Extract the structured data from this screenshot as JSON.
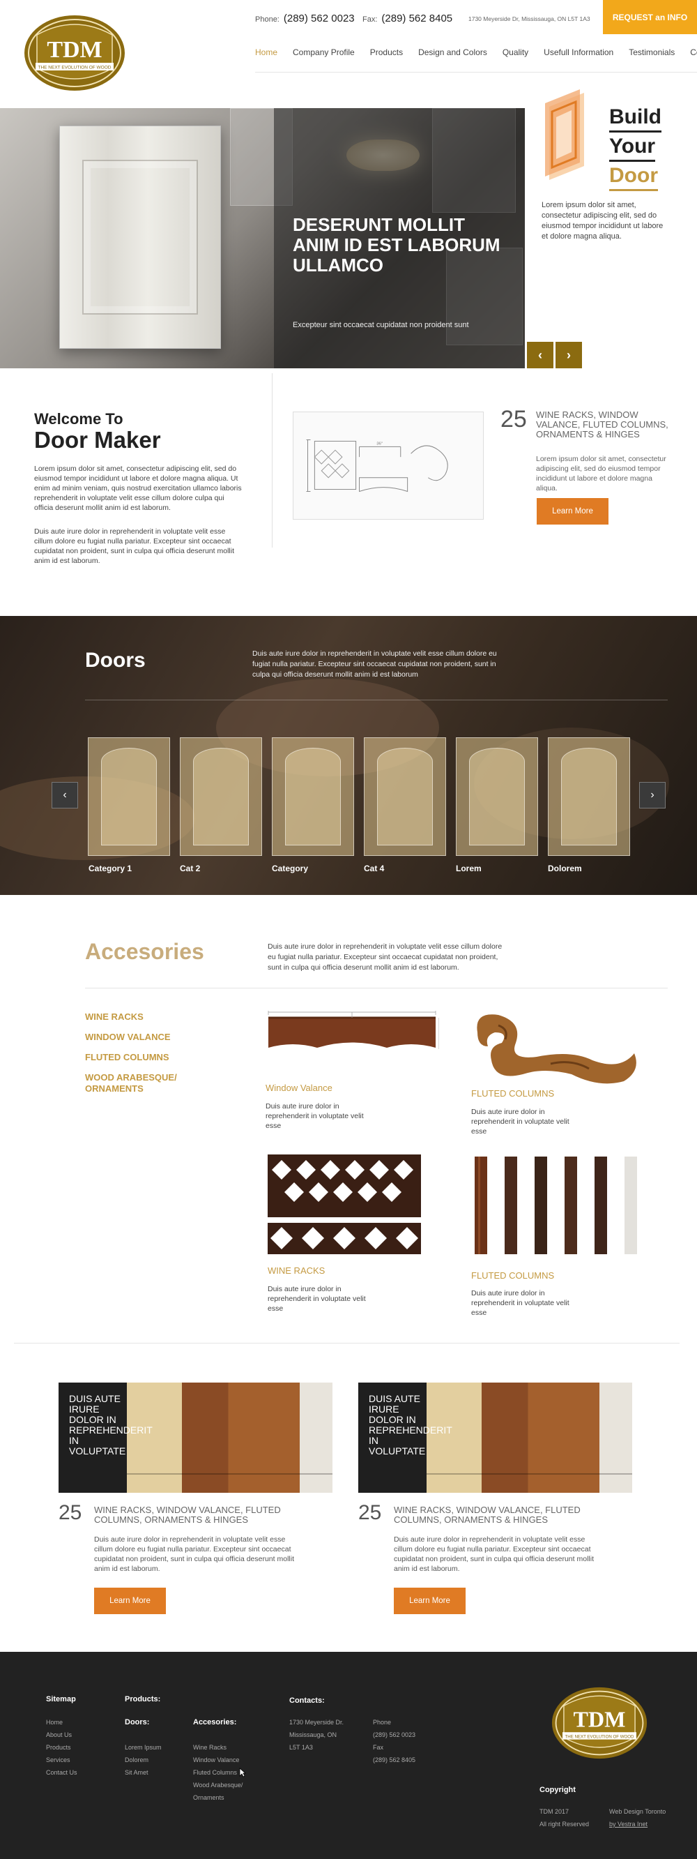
{
  "header": {
    "logo_text": "TDM",
    "logo_tagline": "THE NEXT EVOLUTION OF WOOD",
    "phone_label": "Phone:",
    "phone": "(289) 562 0023",
    "fax_label": "Fax:",
    "fax": "(289) 562 8405",
    "address": "1730 Meyerside Dr, Mississauga, ON L5T 1A3",
    "request_button": "REQUEST an INFO",
    "nav": [
      "Home",
      "Company Profile",
      "Products",
      "Design and Colors",
      "Quality",
      "Usefull Information",
      "Testimonials",
      "Contact Us"
    ]
  },
  "hero": {
    "title": "DESERUNT MOLLIT ANIM ID EST LABORUM ULLAMCO",
    "subtitle": "Excepteur sint occaecat cupidatat non proident sunt",
    "prev": "‹",
    "next": "›",
    "build_lines": [
      "Build",
      "Your",
      "Door"
    ],
    "build_text": "Lorem ipsum dolor sit amet, consectetur adipiscing elit, sed do eiusmod tempor incididunt ut labore et dolore magna aliqua."
  },
  "welcome": {
    "line1": "Welcome To",
    "line2": "Door Maker",
    "p1": "Lorem ipsum dolor sit amet, consectetur adipiscing elit, sed do eiusmod tempor incididunt ut labore et dolore magna aliqua. Ut enim ad minim veniam, quis nostrud exercitation ullamco laboris reprehenderit in voluptate velit esse cillum dolore culpa qui officia deserunt mollit anim id est laborum.",
    "p2": "Duis aute irure dolor in reprehenderit in voluptate velit esse cillum dolore eu fugiat nulla pariatur. Excepteur sint occaecat cupidatat non proident, sunt in culpa qui officia deserunt mollit anim id est laborum.",
    "number": "25",
    "feature_title": "WINE RACKS, WINDOW VALANCE, FLUTED COLUMNS, ORNAMENTS & HINGES",
    "feature_text": "Lorem ipsum dolor sit amet, consectetur adipiscing elit, sed do eiusmod tempor incididunt ut labore et dolore magna aliqua.",
    "button": "Learn More"
  },
  "doors": {
    "title": "Doors",
    "text": "Duis aute irure dolor in reprehenderit in voluptate velit esse cillum dolore eu fugiat nulla pariatur. Excepteur sint occaecat cupidatat non proident, sunt in culpa qui officia deserunt mollit anim id est laborum",
    "prev": "‹",
    "next": "›",
    "categories": [
      "Category 1",
      "Cat 2",
      "Category",
      "Cat 4",
      "Lorem",
      "Dolorem"
    ]
  },
  "accessories": {
    "title": "Accesories",
    "text": "Duis aute irure dolor in reprehenderit in voluptate velit esse cillum dolore eu fugiat nulla pariatur. Excepteur sint occaecat cupidatat non proident, sunt in culpa qui officia deserunt mollit anim id est laborum.",
    "list": [
      "WINE RACKS",
      "WINDOW VALANCE",
      "FLUTED COLUMNS",
      "WOOD ARABESQUE/ ORNAMENTS"
    ],
    "items": [
      {
        "caption": "Window Valance",
        "text": "Duis aute irure dolor in reprehenderit in voluptate velit esse"
      },
      {
        "caption": "FLUTED COLUMNS",
        "text": "Duis aute irure dolor in reprehenderit in voluptate velit esse"
      },
      {
        "caption": "WINE RACKS",
        "text": "Duis aute irure dolor in reprehenderit in voluptate velit esse"
      },
      {
        "caption": "FLUTED COLUMNS",
        "text": "Duis aute irure dolor in reprehenderit in voluptate velit esse"
      }
    ]
  },
  "promos": [
    {
      "overlay": "DUIS AUTE IRURE DOLOR IN REPREHENDERIT IN VOLUPTATE",
      "number": "25",
      "title": "WINE RACKS, WINDOW VALANCE, FLUTED COLUMNS, ORNAMENTS & HINGES",
      "text": "Duis aute irure dolor in reprehenderit in voluptate velit esse cillum dolore eu fugiat nulla pariatur. Excepteur sint occaecat cupidatat non proident, sunt in culpa qui officia deserunt mollit anim id est laborum.",
      "button": "Learn More"
    },
    {
      "overlay": "DUIS AUTE IRURE DOLOR IN REPREHENDERIT IN VOLUPTATE",
      "number": "25",
      "title": "WINE RACKS, WINDOW VALANCE, FLUTED COLUMNS, ORNAMENTS & HINGES",
      "text": "Duis aute irure dolor in reprehenderit in voluptate velit esse cillum dolore eu fugiat nulla pariatur. Excepteur sint occaecat cupidatat non proident, sunt in culpa qui officia deserunt mollit anim id est laborum.",
      "button": "Learn More"
    }
  ],
  "footer": {
    "sitemap_title": "Sitemap",
    "sitemap": [
      "Home",
      "About Us",
      "Products",
      "Services",
      "Contact Us"
    ],
    "products_title": "Products:",
    "doors_title": "Doors:",
    "doors": [
      "Lorem Ipsum",
      "Dolorem",
      "Sit Amet"
    ],
    "acc_title": "Accesories:",
    "acc": [
      "Wine Racks",
      "Window Valance",
      "Fluted Columns",
      "Wood Arabesque/",
      "Ornaments"
    ],
    "contacts_title": "Contacts:",
    "address": [
      "1730 Meyerside Dr.",
      "Mississauga, ON",
      "L5T 1A3"
    ],
    "phones": [
      "Phone",
      "(289) 562 0023",
      "Fax",
      "(289) 562 8405"
    ],
    "copyright_title": "Copyright",
    "copy_left": [
      "TDM 2017",
      "All right Reserved"
    ],
    "copy_right": [
      "Web Design Toronto",
      "by Vestra Inet"
    ]
  }
}
